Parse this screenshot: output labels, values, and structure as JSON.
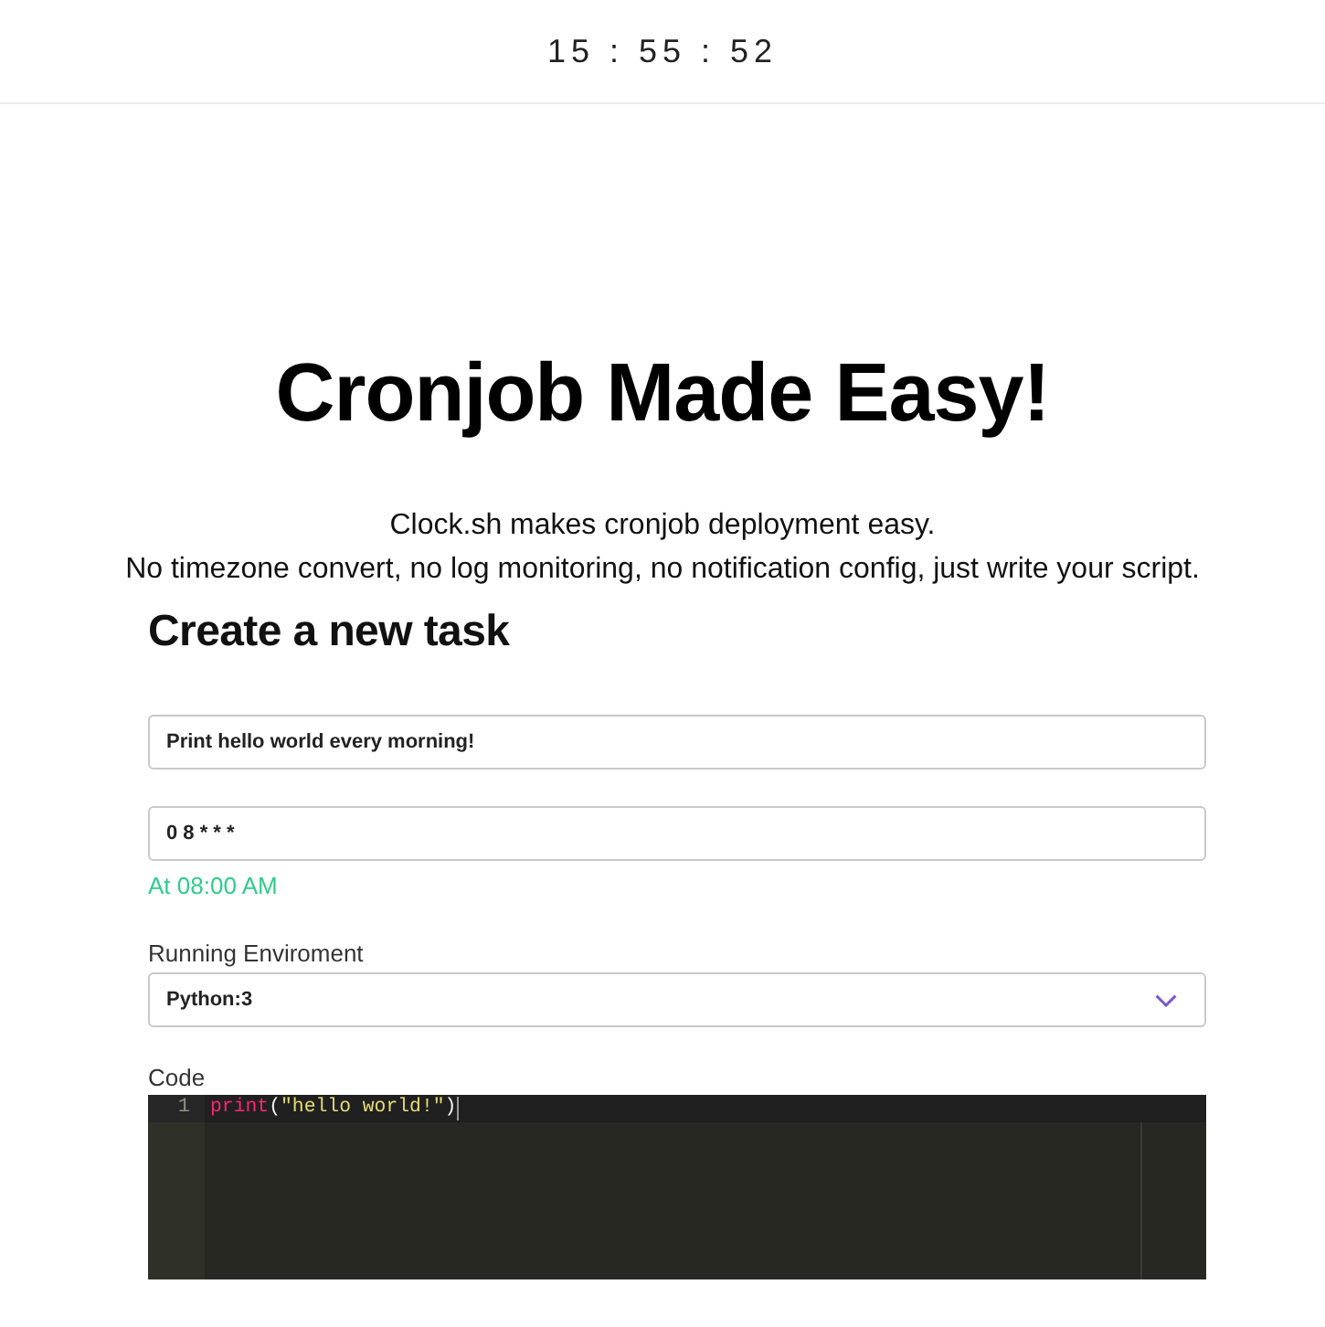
{
  "header": {
    "clock": "15 : 55 : 52"
  },
  "hero": {
    "title": "Cronjob Made Easy!",
    "lines": [
      "Clock.sh makes cronjob deployment easy.",
      "No timezone convert, no log monitoring, no notification config, just write your script."
    ]
  },
  "form": {
    "title": "Create a new task",
    "name_field": {
      "value": "Print hello world every morning!"
    },
    "schedule_field": {
      "value": "0 8 * * *",
      "hint": "At 08:00 AM"
    },
    "environment": {
      "label": "Running Enviroment",
      "value": "Python:3"
    },
    "code": {
      "label": "Code",
      "lines": [
        {
          "number": "1",
          "active": true,
          "tokens": [
            {
              "kind": "function",
              "text": "print"
            },
            {
              "kind": "punct",
              "text": "("
            },
            {
              "kind": "string",
              "text": "\"hello world!\""
            },
            {
              "kind": "punct",
              "text": ")"
            }
          ]
        }
      ]
    }
  }
}
